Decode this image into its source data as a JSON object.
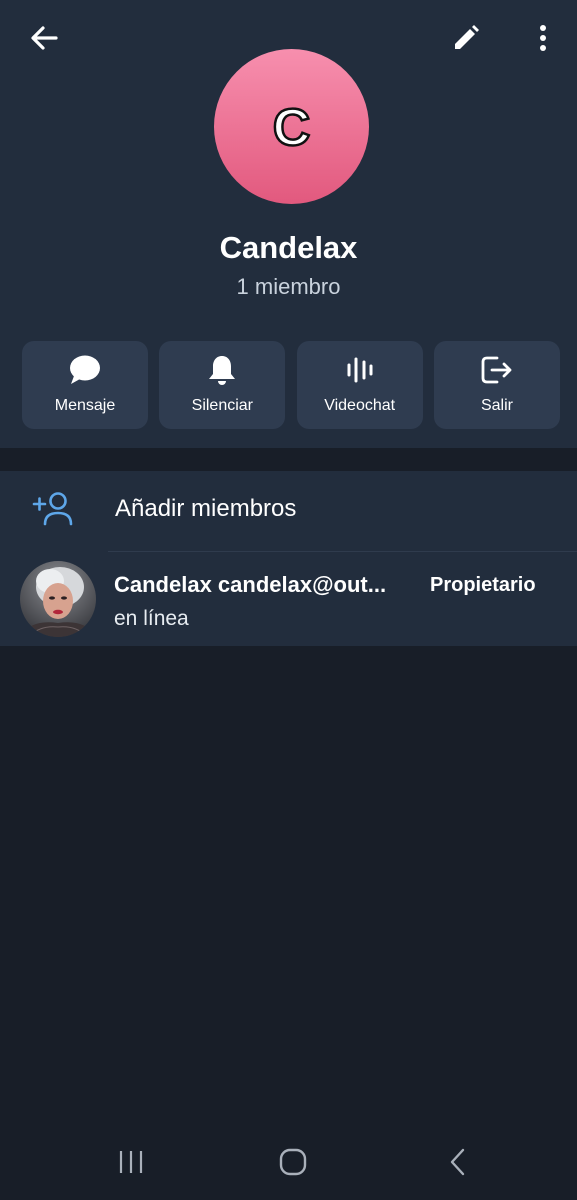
{
  "header": {
    "back_icon": "arrow-left-icon",
    "edit_icon": "pencil-icon",
    "more_icon": "more-vert-icon",
    "avatar_letter": "C",
    "avatar_colors": [
      "#f78fae",
      "#e2597e"
    ],
    "name": "Candelax",
    "member_count": "1 miembro"
  },
  "actions": [
    {
      "label": "Mensaje",
      "icon": "chat-bubble-icon"
    },
    {
      "label": "Silenciar",
      "icon": "bell-icon"
    },
    {
      "label": "Videochat",
      "icon": "voice-wave-icon"
    },
    {
      "label": "Salir",
      "icon": "exit-icon"
    }
  ],
  "members_section": {
    "add_label": "Añadir miembros",
    "add_icon": "person-add-icon",
    "members": [
      {
        "name": "Candelax candelax@out...",
        "status": "en línea",
        "role": "Propietario"
      }
    ]
  },
  "navbar": {
    "recent_icon": "recent-apps-icon",
    "home_icon": "home-icon",
    "back_icon": "nav-back-icon"
  },
  "colors": {
    "background": "#181e28",
    "header_bg": "#222d3d",
    "action_bg": "#2f3c50",
    "accent_icon": "#5ea7ea"
  }
}
